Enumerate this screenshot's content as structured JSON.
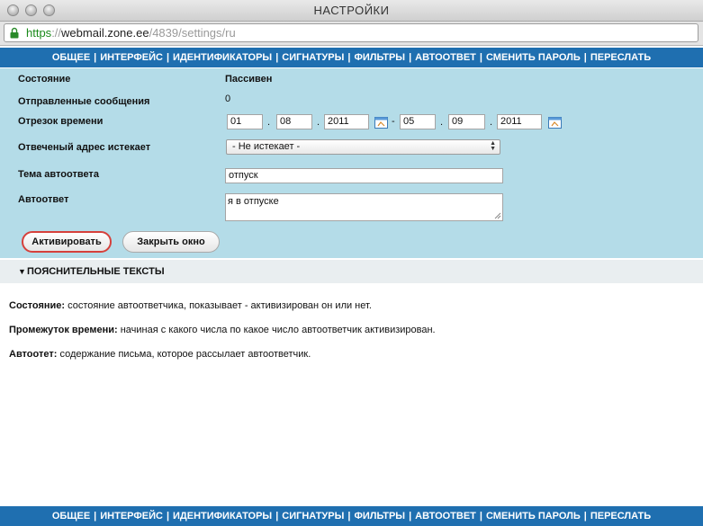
{
  "window": {
    "title": "НАСТРОЙКИ"
  },
  "urlbar": {
    "scheme": "https",
    "sep": "://",
    "domain": "webmail.zone.ee",
    "path": "/4839/settings/ru"
  },
  "nav": {
    "items": [
      "ОБЩЕЕ",
      "ИНТЕРФЕЙС",
      "ИДЕНТИФИКАТОРЫ",
      "СИГНАТУРЫ",
      "ФИЛЬТРЫ",
      "АВТООТВЕТ",
      "СМЕНИТЬ ПАРОЛЬ",
      "ПЕРЕСЛАТЬ"
    ],
    "separator": "|"
  },
  "form": {
    "status": {
      "label": "Состояние",
      "value": "Пассивен"
    },
    "sent": {
      "label": "Отправленные сообщения",
      "value": "0"
    },
    "period": {
      "label": "Отрезок времени",
      "from": {
        "day": "01",
        "month": "08",
        "year": "2011"
      },
      "dash": "-",
      "dot": ".",
      "to": {
        "day": "05",
        "month": "09",
        "year": "2011"
      }
    },
    "expires": {
      "label": "Отвеченый адрес истекает",
      "selected": "- Не истекает -"
    },
    "subject": {
      "label": "Тема автоответа",
      "value": "отпуск"
    },
    "reply": {
      "label": "Автоответ",
      "value": "я в отпуске"
    }
  },
  "buttons": {
    "activate": "Активировать",
    "close": "Закрыть окно"
  },
  "explanations": {
    "header": "ПОЯСНИТЕЛЬНЫЕ ТЕКСТЫ",
    "items": [
      {
        "term": "Состояние:",
        "text": " состояние автоответчика, показывает - активизирован он или нет."
      },
      {
        "term": "Промежуток времени:",
        "text": " начиная с какого числа по какое число автоответчик активизирован."
      },
      {
        "term": "Автоотет:",
        "text": " содержание письма, которое рассылает автоответчик."
      }
    ]
  },
  "colors": {
    "nav": "#1f6fb0",
    "panel": "#b4dce8",
    "activate_outline": "#d6403b"
  }
}
